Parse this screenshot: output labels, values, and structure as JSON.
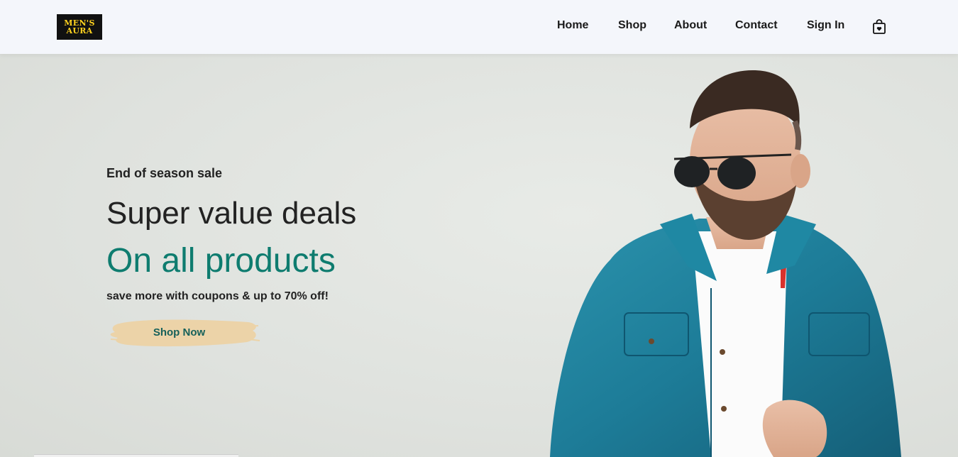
{
  "logo": {
    "line1": "MEN'S",
    "line2": "AURA",
    "bg": "#111111",
    "color": "#ffd21f"
  },
  "nav": {
    "items": [
      {
        "label": "Home"
      },
      {
        "label": "Shop"
      },
      {
        "label": "About"
      },
      {
        "label": "Contact"
      },
      {
        "label": "Sign In"
      }
    ],
    "cart_icon": "shopping-bag-icon"
  },
  "hero": {
    "eyebrow": "End of season sale",
    "headline": "Super value deals",
    "headline_accent": "On all products",
    "subline": "save more with coupons & up to 70% off!",
    "cta_label": "Shop Now",
    "accent_color": "#0e7c6f",
    "cta_brush_color": "#ecd3a8",
    "image": "man-in-denim-jacket-and-sunglasses"
  }
}
